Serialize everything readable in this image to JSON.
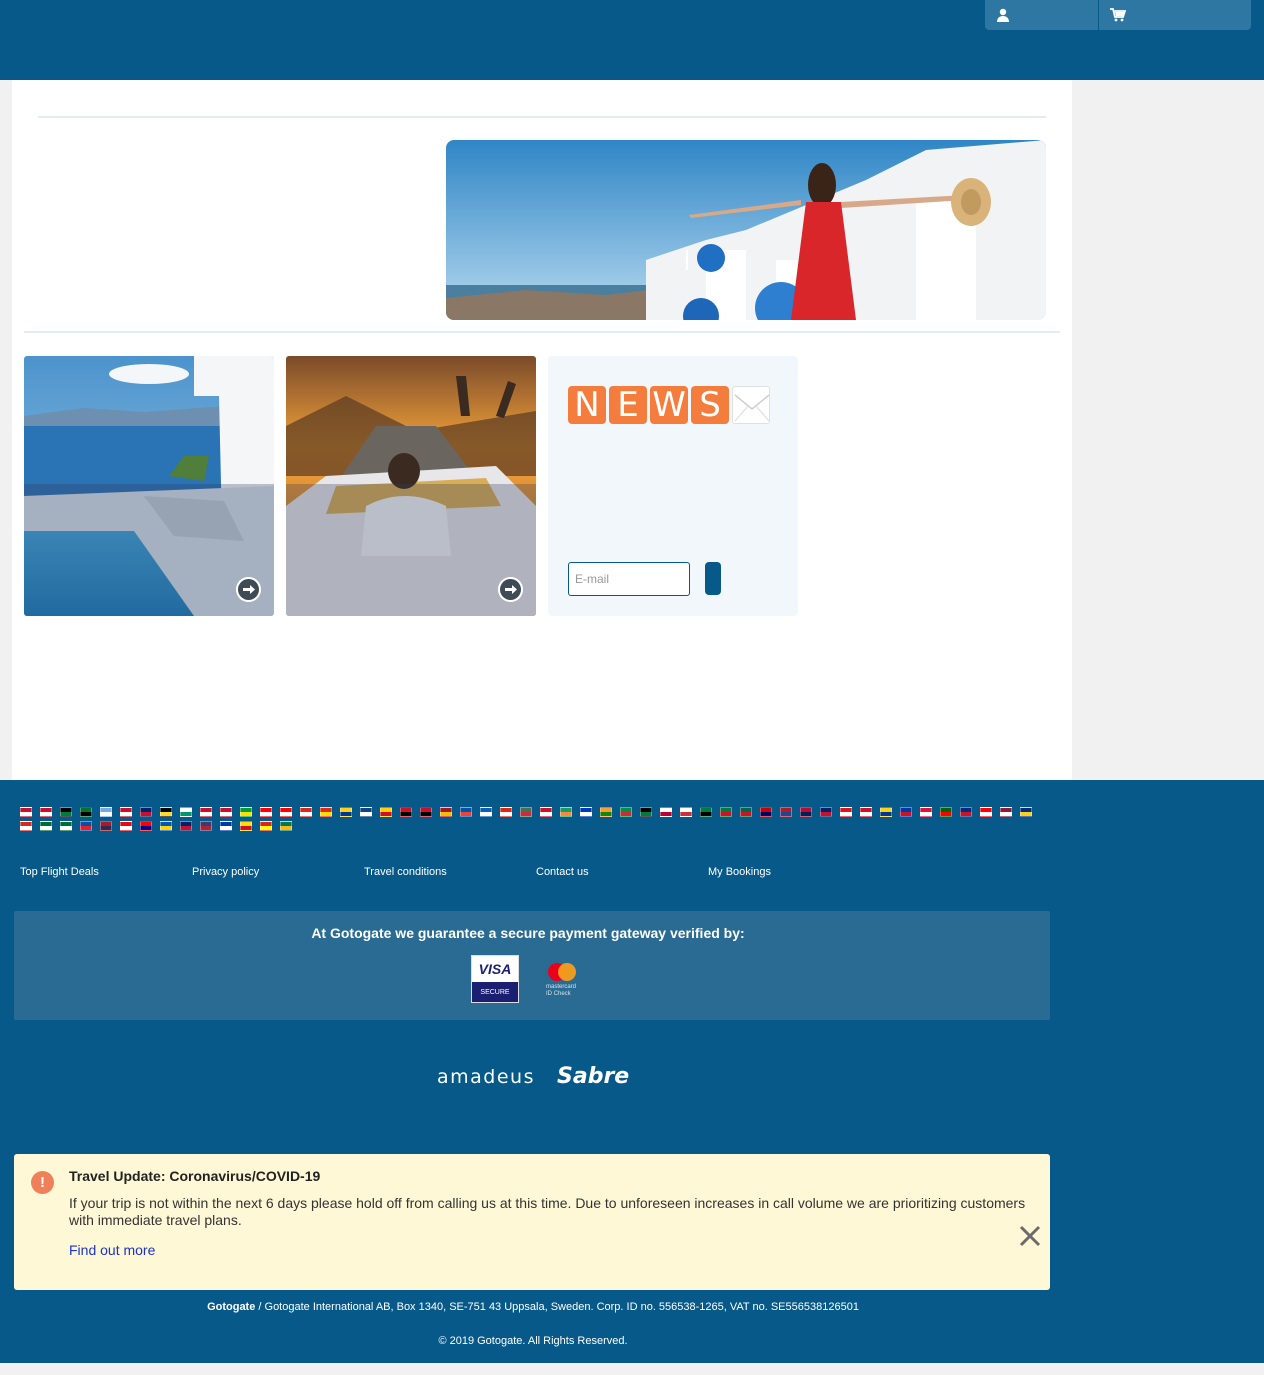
{
  "header": {
    "user_icon": "user-icon",
    "cart_icon": "cart-icon"
  },
  "hero": {
    "image": "santorini-woman-red-dress"
  },
  "cards": [
    {
      "image": "santorini-pool",
      "action_icon": "arrow-right-circle-icon"
    },
    {
      "image": "convertible-road-trip",
      "action_icon": "arrow-right-circle-icon"
    }
  ],
  "newsletter": {
    "logo_letters": [
      "N",
      "E",
      "W",
      "S"
    ],
    "email_placeholder": "E-mail"
  },
  "footer": {
    "links": [
      "Top Flight Deals",
      "Privacy policy",
      "Travel conditions",
      "Contact us",
      "My Bookings"
    ],
    "secure_title": "At Gotogate we guarantee a secure payment gateway verified by:",
    "visa": {
      "brand": "VISA",
      "label": "SECURE"
    },
    "mastercard": {
      "line1": "mastercard",
      "line2": "ID Check"
    },
    "partners": [
      "amadeus",
      "Sabre"
    ],
    "covid": {
      "title": "Travel Update: Coronavirus/COVID-19",
      "text": "If your trip is not within the next 6 days please hold off from calling us at this time. Due to unforeseen increases in call volume we are prioritizing customers with immediate travel plans.",
      "link": "Find out more"
    },
    "company_name": "Gotogate",
    "company_info": " / Gotogate International AB, Box 1340, SE-751 43 Uppsala, Sweden. Corp. ID no. 556538-1265, VAT no. SE556538126501",
    "copyright": "© 2019 Gotogate. All Rights Reserved."
  },
  "colors": {
    "brand": "#07598a",
    "accent": "#f47c3c",
    "notice": "#fef8d6",
    "link": "#1b33c9"
  },
  "flags": [
    [
      "#c8102e",
      "#ffffff"
    ],
    [
      "#c8102e",
      "#ffffff"
    ],
    [
      "#000000",
      "#007a3d"
    ],
    [
      "#00732f",
      "#000000"
    ],
    [
      "#74acdf",
      "#ffffff"
    ],
    [
      "#c8102e",
      "#ffffff"
    ],
    [
      "#012169",
      "#c8102e"
    ],
    [
      "#000000",
      "#fdda24"
    ],
    [
      "#ffffff",
      "#00966e"
    ],
    [
      "#c8102e",
      "#ffffff"
    ],
    [
      "#c8102e",
      "#ffffff"
    ],
    [
      "#009c3b",
      "#ffdf00"
    ],
    [
      "#ff0000",
      "#ffffff"
    ],
    [
      "#ff0000",
      "#ffffff"
    ],
    [
      "#d52b1e",
      "#ffffff"
    ],
    [
      "#de2910",
      "#ffde00"
    ],
    [
      "#fcd116",
      "#003893"
    ],
    [
      "#11457e",
      "#ffffff"
    ],
    [
      "#ffd100",
      "#ce1126"
    ],
    [
      "#ce1126",
      "#000000"
    ],
    [
      "#c8102e",
      "#000000"
    ],
    [
      "#aa151b",
      "#f1bf00"
    ],
    [
      "#0055a4",
      "#ef4135"
    ],
    [
      "#0d5eaf",
      "#ffffff"
    ],
    [
      "#de2910",
      "#ffffff"
    ],
    [
      "#477050",
      "#cd2a3e"
    ],
    [
      "#ce1126",
      "#ffffff"
    ],
    [
      "#169b62",
      "#ff883e"
    ],
    [
      "#0038b8",
      "#ffffff"
    ],
    [
      "#ff9933",
      "#138808"
    ],
    [
      "#009246",
      "#ce2b37"
    ],
    [
      "#000000",
      "#007a3d"
    ],
    [
      "#ffffff",
      "#bc002d"
    ],
    [
      "#ffffff",
      "#cd2e3a"
    ],
    [
      "#007a3d",
      "#000000"
    ],
    [
      "#007a3d",
      "#ce1126"
    ],
    [
      "#006847",
      "#ce1126"
    ],
    [
      "#cc0001",
      "#010066"
    ],
    [
      "#ae1c28",
      "#21468b"
    ],
    [
      "#ba0c2f",
      "#00205b"
    ],
    [
      "#012169",
      "#c8102e"
    ],
    [
      "#db161b",
      "#ffffff"
    ],
    [
      "#ce1126",
      "#ffffff"
    ],
    [
      "#fcd116",
      "#003893"
    ],
    [
      "#0038a8",
      "#ce1126"
    ],
    [
      "#dc143c",
      "#ffffff"
    ],
    [
      "#006600",
      "#ff0000"
    ],
    [
      "#002b7f",
      "#ce1126"
    ],
    [
      "#ff0000",
      "#ffffff"
    ],
    [
      "#8d1b3d",
      "#ffffff"
    ],
    [
      "#002b7f",
      "#fcd116"
    ],
    [
      "#d52b1e",
      "#ffffff"
    ],
    [
      "#006c35",
      "#ffffff"
    ],
    [
      "#006c35",
      "#ffffff"
    ],
    [
      "#0b4ea2",
      "#ee1c25"
    ],
    [
      "#a51931",
      "#2d2a4a"
    ],
    [
      "#e30a17",
      "#ffffff"
    ],
    [
      "#fe0000",
      "#000095"
    ],
    [
      "#0057b7",
      "#ffd700"
    ],
    [
      "#012169",
      "#c8102e"
    ],
    [
      "#3c3b6e",
      "#b22234"
    ],
    [
      "#0038a8",
      "#ffffff"
    ],
    [
      "#fcdd09",
      "#ce1126"
    ],
    [
      "#da251d",
      "#ffff00"
    ],
    [
      "#007a4d",
      "#ffb612"
    ]
  ]
}
